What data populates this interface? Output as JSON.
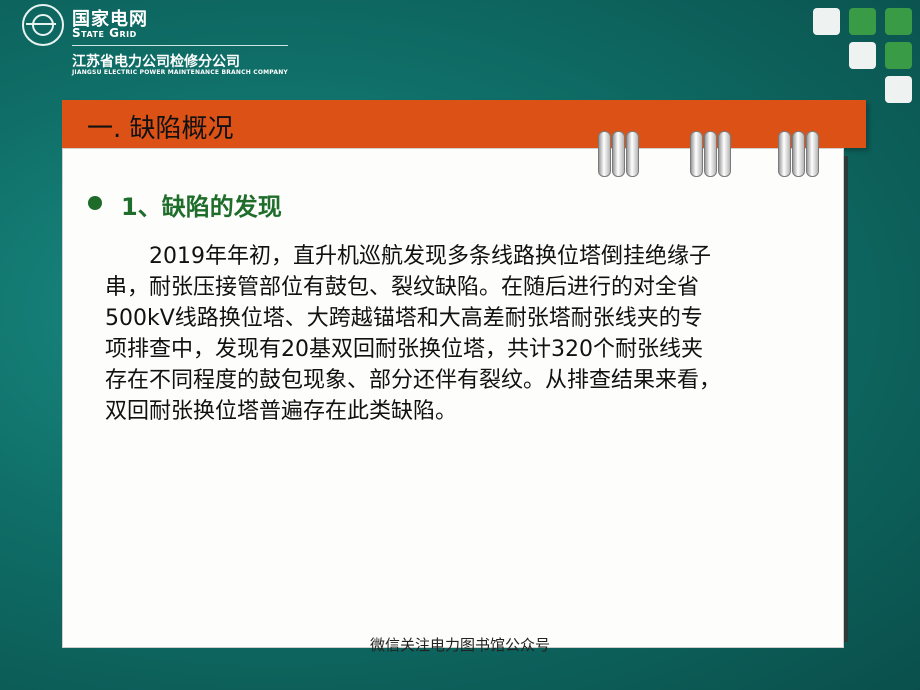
{
  "header": {
    "brand_cn": "国家电网",
    "brand_en": "State Grid",
    "company_cn": "江苏省电力公司检修分公司",
    "company_en": "JIANGSU ELECTRIC POWER MAINTENANCE BRANCH COMPANY"
  },
  "colors": {
    "background": "#127a72",
    "title_bar": "#dc5216",
    "section_title": "#1e6d2a",
    "square_light": "#eef3f2",
    "square_green": "#3a9b46"
  },
  "slide": {
    "title": "一.  缺陷概况",
    "section_title": "1、缺陷的发现",
    "paragraph_lines": [
      "2019年年初，直升机巡航发现多条线路换位塔倒挂绝缘子",
      "串，耐张压接管部位有鼓包、裂纹缺陷。在随后进行的对全省",
      "500kV线路换位塔、大跨越锚塔和大高差耐张塔耐张线夹的专",
      "项排查中，发现有20基双回耐张换位塔，共计320个耐张线夹",
      "存在不同程度的鼓包现象、部分还伴有裂纹。从排查结果来看，",
      "双回耐张换位塔普遍存在此类缺陷。"
    ]
  },
  "footer": {
    "text": "微信关注电力图书馆公众号"
  },
  "icons": [
    "state-grid-logo-icon",
    "binder-ring-icon",
    "bullet-dot-icon"
  ]
}
